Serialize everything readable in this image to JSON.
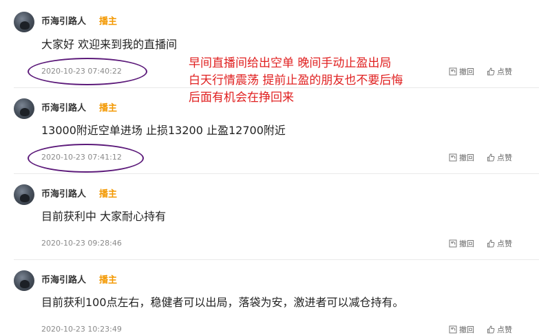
{
  "posts": [
    {
      "author": "币海引路人",
      "badge": "播主",
      "content": "大家好 欢迎来到我的直播间",
      "time": "2020-10-23 07:40:22",
      "revoke": "撤回",
      "like": "点赞"
    },
    {
      "author": "币海引路人",
      "badge": "播主",
      "content": "13000附近空单进场 止损13200 止盈12700附近",
      "time": "2020-10-23 07:41:12",
      "revoke": "撤回",
      "like": "点赞"
    },
    {
      "author": "币海引路人",
      "badge": "播主",
      "content": "目前获利中 大家耐心持有",
      "time": "2020-10-23 09:28:46",
      "revoke": "撤回",
      "like": "点赞"
    },
    {
      "author": "币海引路人",
      "badge": "播主",
      "content": "目前获利100点左右，稳健者可以出局，落袋为安，激进者可以减仓持有。",
      "time": "2020-10-23 10:23:49",
      "revoke": "撤回",
      "like": "点赞"
    }
  ],
  "annotation": {
    "lines": [
      "早间直播间给出空单  晚间手动止盈出局",
      "白天行情震荡  提前止盈的朋友也不要后悔",
      "后面有机会在挣回来"
    ],
    "color": "#e02020"
  },
  "colors": {
    "badge": "#f39800",
    "circle": "#5c1a7a"
  },
  "icons": {
    "revoke": "undo-icon",
    "like": "thumbs-up-icon"
  }
}
